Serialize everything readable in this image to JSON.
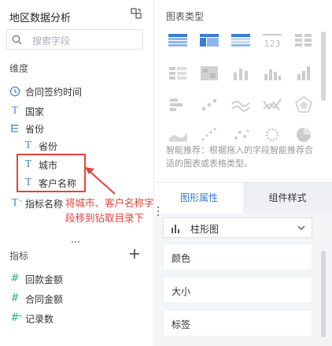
{
  "left": {
    "title": "地区数据分析",
    "search_placeholder": "搜索字段",
    "dimension_section": "维度",
    "dimensions": [
      {
        "icon": "clock-icon",
        "label": "合同签约时间"
      },
      {
        "icon": "text-field-icon",
        "label": "国家"
      },
      {
        "icon": "hierarchy-icon",
        "label": "省份"
      },
      {
        "icon": "text-field-icon",
        "label": "省份"
      },
      {
        "icon": "text-field-icon",
        "label": "城市"
      },
      {
        "icon": "text-field-icon",
        "label": "客户名称"
      },
      {
        "icon": "calculated-text-icon",
        "label": "指标名称"
      }
    ],
    "measure_section": "指标",
    "measures": [
      {
        "icon": "number-icon",
        "label": "回款金额"
      },
      {
        "icon": "number-icon",
        "label": "合同金额"
      },
      {
        "icon": "calculated-number-icon",
        "label": "记录数"
      }
    ]
  },
  "annotation": {
    "text": "将城市、客户名称字段移到钻取目录下",
    "color": "#e0443c"
  },
  "right": {
    "chart_type_title": "图表类型",
    "hint": "智能推荐：根据拖入的字段智能推荐合适的图表或表格类型。",
    "tabs": [
      "图形属性",
      "组件样式"
    ],
    "chart_select_label": "柱形图",
    "properties": [
      "颜色",
      "大小",
      "标签"
    ]
  },
  "colors": {
    "accent": "#3a7bd5",
    "dimension_icon": "#4c86d8",
    "measure_icon": "#2cb47a",
    "annotation": "#e0443c"
  }
}
